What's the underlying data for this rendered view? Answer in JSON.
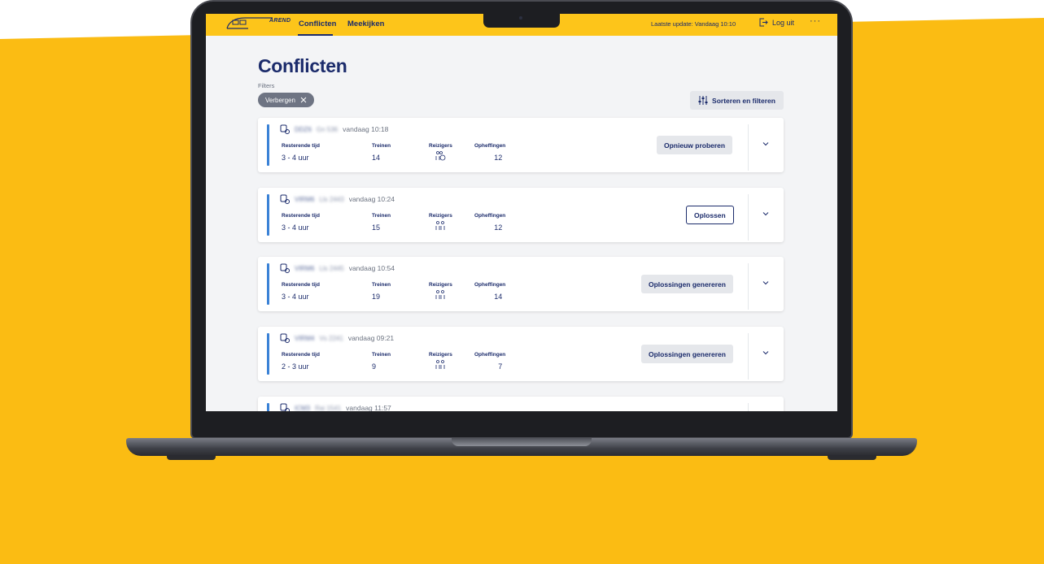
{
  "colors": {
    "accent_yellow": "#fdc51a",
    "brand_navy": "#1b2b6b",
    "status_blue": "#3b82d6"
  },
  "header": {
    "logo_text": "AREND",
    "nav": [
      "Conflicten",
      "Meekijken"
    ],
    "last_update": "Laatste update: Vandaag 10:10",
    "logout": "Log uit",
    "more": "···"
  },
  "page": {
    "title": "Conflicten",
    "filters_label": "Filters",
    "chip": "Verbergen",
    "sort_button": "Sorteren en filteren"
  },
  "columns": {
    "remaining": "Resterende tijd",
    "trains": "Treinen",
    "passengers": "Reizigers",
    "cancellations": "Opheffingen"
  },
  "cards": [
    {
      "id": "DDZ6",
      "route": "Gn 536",
      "time": "vandaag 10:18",
      "remaining": "3 - 4 uur",
      "trains": "14",
      "cancellations": "12",
      "action": "Opnieuw proberen",
      "passenger_icon": "people-clock-icon"
    },
    {
      "id": "VIRM6",
      "route": "Lls 2443",
      "time": "vandaag 10:24",
      "remaining": "3 - 4 uur",
      "trains": "15",
      "cancellations": "12",
      "action": "Oplossen",
      "passenger_icon": "people-icon"
    },
    {
      "id": "VIRM6",
      "route": "Lls 2445",
      "time": "vandaag 10:54",
      "remaining": "3 - 4 uur",
      "trains": "19",
      "cancellations": "14",
      "action": "Oplossingen genereren",
      "passenger_icon": "people-icon"
    },
    {
      "id": "VIRM4",
      "route": "Vs 2241",
      "time": "vandaag 09:21",
      "remaining": "2 - 3 uur",
      "trains": "9",
      "cancellations": "7",
      "action": "Oplossingen genereren",
      "passenger_icon": "people-icon"
    },
    {
      "id": "ICM3",
      "route": "Rai 1541",
      "time": "vandaag 11:57"
    }
  ]
}
